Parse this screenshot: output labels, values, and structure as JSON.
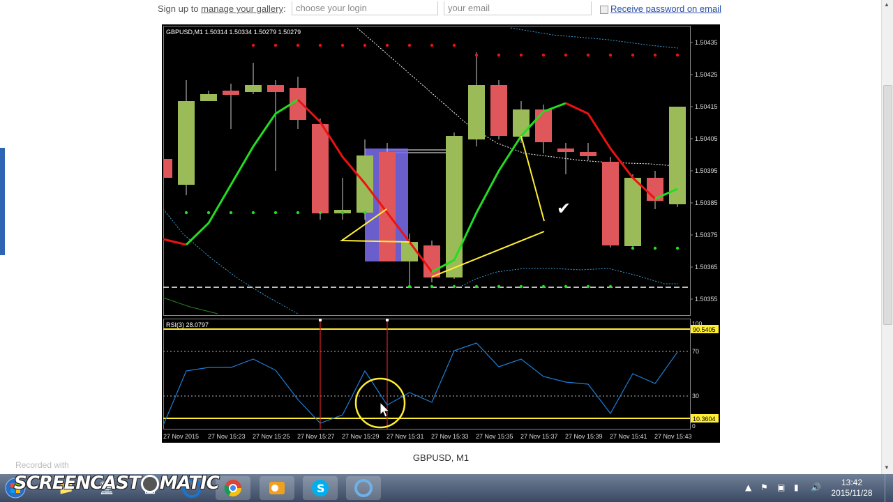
{
  "signup": {
    "prefix": "Sign up to ",
    "link": "manage your gallery",
    "suffix": ":",
    "login_placeholder": "choose your login",
    "email_placeholder": "your email",
    "receive_label": "Receive password on email"
  },
  "chart": {
    "header": "GBPUSD,M1  1.50314 1.50334 1.50279 1.50279",
    "price_labels": [
      "1.50435",
      "1.50425",
      "1.50415",
      "1.50405",
      "1.50395",
      "1.50385",
      "1.50375",
      "1.50365",
      "1.50355"
    ],
    "rsi_header": "RSI(3) 28.0797",
    "rsi_levels": [
      "100",
      "70",
      "30",
      "0"
    ],
    "rsi_box_high": "90.5405",
    "rsi_box_low": "10.3604",
    "time_labels": [
      "27 Nov 2015",
      "27 Nov 15:23",
      "27 Nov 15:25",
      "27 Nov 15:27",
      "27 Nov 15:29",
      "27 Nov 15:31",
      "27 Nov 15:33",
      "27 Nov 15:35",
      "27 Nov 15:37",
      "27 Nov 15:39",
      "27 Nov 15:41",
      "27 Nov 15:43"
    ]
  },
  "caption": "GBPUSD, M1",
  "recorder": {
    "recorded_with": "Recorded with",
    "brand_left": "SCREENCAST",
    "brand_right": "MATIC"
  },
  "taskbar": {
    "time": "13:42",
    "date": "2015/11/28"
  },
  "colors": {
    "bull": "#9bbb59",
    "bear": "#e0575b",
    "ma_up": "#22dd22",
    "ma_down": "#ee1111",
    "rsi_line": "#1e7fd8",
    "yellow": "#ffee33"
  }
}
